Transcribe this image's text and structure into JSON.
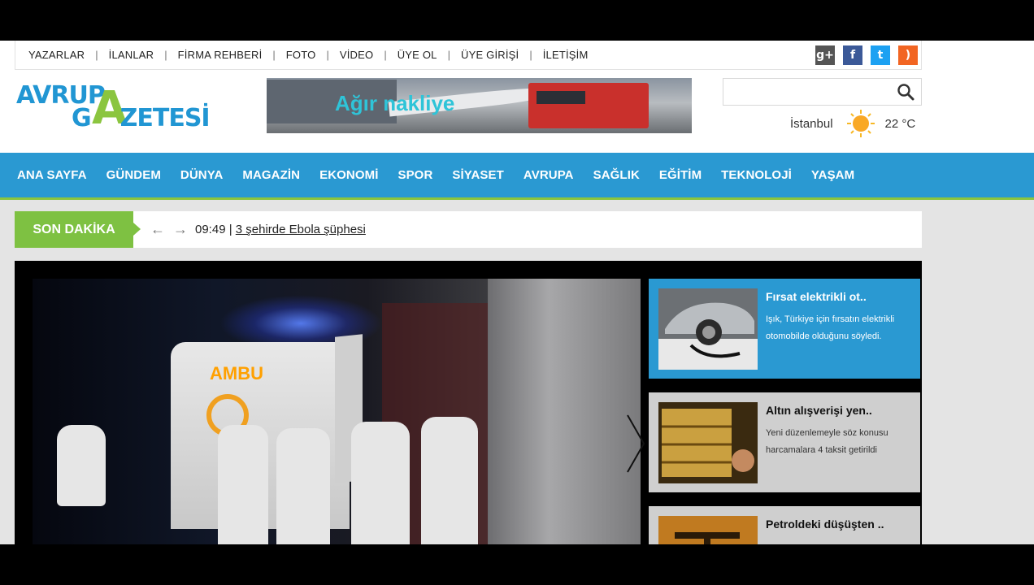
{
  "topnav": {
    "links": [
      "YAZARLAR",
      "İLANLAR",
      "FİRMA REHBERİ",
      "FOTO",
      "VİDEO",
      "ÜYE OL",
      "ÜYE GİRİŞİ",
      "İLETİŞİM"
    ],
    "separator": "|"
  },
  "social": {
    "gplus": "g+",
    "facebook": "f",
    "twitter": "t",
    "rss": ")"
  },
  "logo": {
    "line1": "AVRUP",
    "big_letter": "A",
    "line2": "G",
    "line2b": "ZETESİ"
  },
  "banner": {
    "text": "Ağır nakliye"
  },
  "search": {
    "placeholder": ""
  },
  "weather": {
    "city": "İstanbul",
    "temp": "22 °C"
  },
  "mainnav": {
    "items": [
      "ANA SAYFA",
      "GÜNDEM",
      "DÜNYA",
      "MAGAZİN",
      "EKONOMİ",
      "SPOR",
      "SİYASET",
      "AVRUPA",
      "SAĞLIK",
      "EĞİTİM",
      "TEKNOLOJİ",
      "YAŞAM"
    ]
  },
  "breaking": {
    "label": "SON DAKİKA",
    "prev_arrow": "←",
    "next_arrow": "→",
    "time": "09:49",
    "sep": " | ",
    "headline": "3 şehirde Ebola şüphesi"
  },
  "slider": {
    "photo_text": "AMBU",
    "cards": [
      {
        "title": "Fırsat elektrikli ot..",
        "desc": "Işık, Türkiye için fırsatın elektrikli otomobilde olduğunu söyledi."
      },
      {
        "title": "Altın alışverişi yen..",
        "desc": "Yeni düzenlemeyle söz konusu harcamalara 4 taksit getirildi"
      },
      {
        "title": "Petroldeki düşüşten ..",
        "desc": ""
      }
    ]
  },
  "colors": {
    "nav_blue": "#2a99d2",
    "accent_green": "#8bc53f"
  }
}
